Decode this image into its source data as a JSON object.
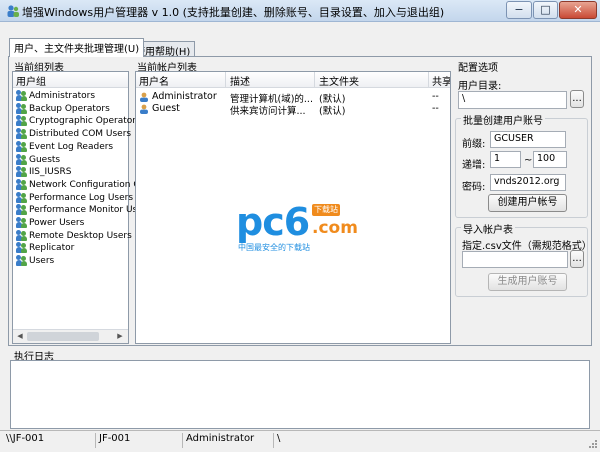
{
  "window": {
    "title": "增强Windows用户管理器 v 1.0 (支持批量创建、删除账号、目录设置、加入与退出组)",
    "minimize_glyph": "−",
    "maximize_glyph": "□",
    "close_glyph": "✕"
  },
  "tabs": [
    {
      "label": "用户、主文件夹批理管理(U)",
      "active": true
    },
    {
      "label": "使用帮助(H)",
      "active": false
    }
  ],
  "groups_panel": {
    "title": "当前组列表",
    "column": "用户组",
    "items": [
      "Administrators",
      "Backup Operators",
      "Cryptographic Operators",
      "Distributed COM Users",
      "Event Log Readers",
      "Guests",
      "IIS_IUSRS",
      "Network Configuration Ope",
      "Performance Log Users",
      "Performance Monitor Users",
      "Power Users",
      "Remote Desktop Users",
      "Replicator",
      "Users"
    ]
  },
  "accounts_panel": {
    "title": "当前帐户列表",
    "columns": [
      "用户名",
      "描述",
      "主文件夹",
      "共享"
    ],
    "rows": [
      {
        "name": "Administrator",
        "desc": "管理计算机(域)的...",
        "home": "(默认)",
        "share": "--"
      },
      {
        "name": "Guest",
        "desc": "供来宾访问计算...",
        "home": "(默认)",
        "share": "--"
      }
    ]
  },
  "config": {
    "title": "配置选项",
    "user_dir_label": "用户目录:",
    "user_dir_value": "\\",
    "browse_label": "...",
    "batch": {
      "title": "批量创建用户账号",
      "prefix_label": "前缀:",
      "prefix_value": "GCUSER",
      "increment_label": "递增:",
      "from_value": "1",
      "tilde": "~",
      "to_value": "100",
      "password_label": "密码:",
      "password_value": "vnds2012.org",
      "create_button": "创建用户帐号"
    },
    "import": {
      "title": "导入帐户表",
      "file_label": "指定.csv文件（需规范格式）",
      "file_value": "",
      "browse_label": "...",
      "generate_button": "生成用户账号"
    }
  },
  "watermark": {
    "brand": "pc6",
    "suffix": ".com",
    "badge": "下载站",
    "tagline": "中国最安全的下载站"
  },
  "log": {
    "title": "执行日志"
  },
  "statusbar": [
    "\\\\JF-001",
    "JF-001",
    "Administrator",
    "\\"
  ],
  "colors": {
    "accent": "#1a75c9",
    "watermark_blue": "#1f8ee0",
    "watermark_orange": "#f08b1d"
  }
}
